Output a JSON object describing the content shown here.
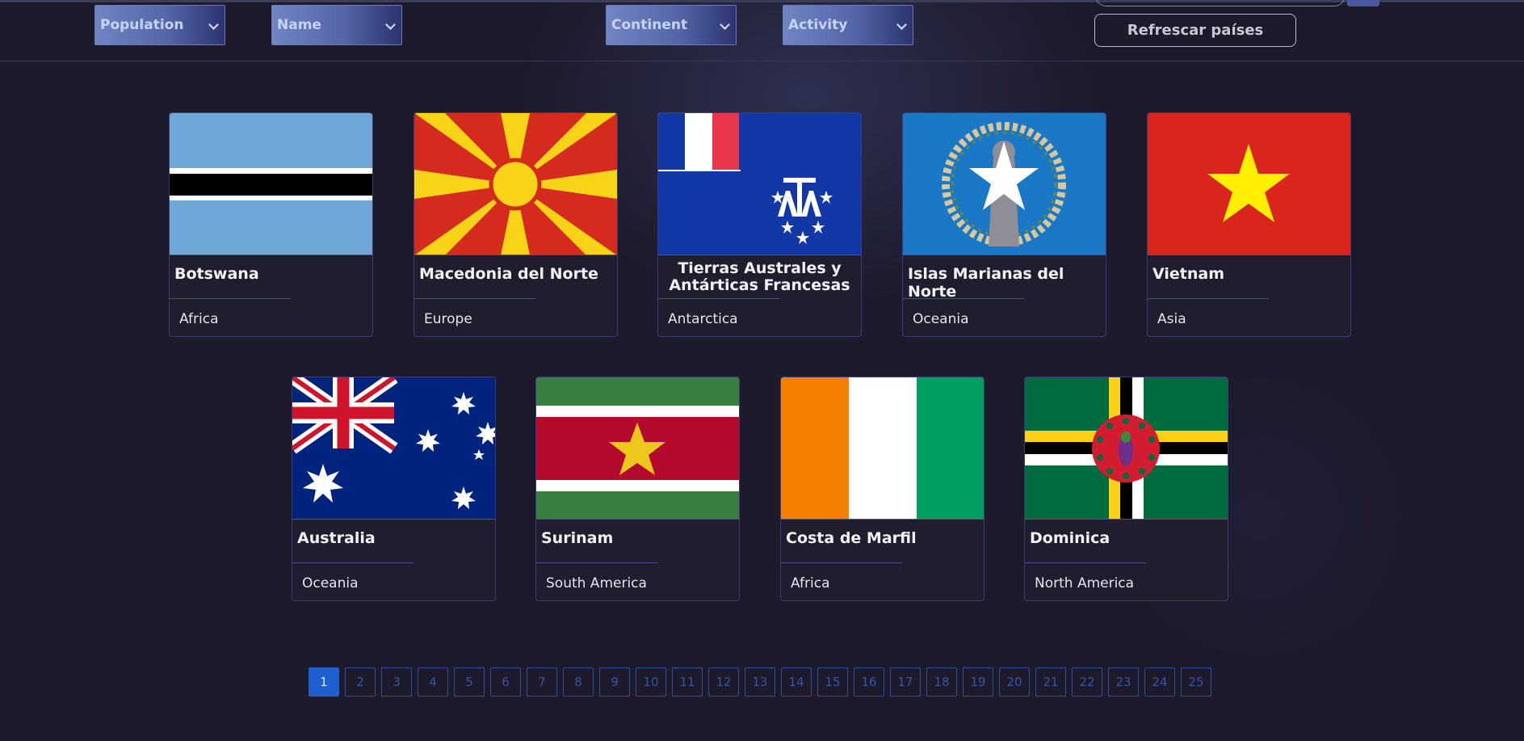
{
  "filters": {
    "population": "Population",
    "name": "Name",
    "continent": "Continent",
    "activity": "Activity"
  },
  "refresh_label": "Refrescar países",
  "countries": [
    {
      "name": "Botswana",
      "continent": "Africa",
      "flag": "botswana-flag"
    },
    {
      "name": "Macedonia del Norte",
      "continent": "Europe",
      "flag": "north-macedonia-flag"
    },
    {
      "name": "Tierras Australes y Antárticas Francesas",
      "continent": "Antarctica",
      "flag": "french-southern-lands-flag"
    },
    {
      "name": "Islas Marianas del Norte",
      "continent": "Oceania",
      "flag": "northern-mariana-islands-flag"
    },
    {
      "name": "Vietnam",
      "continent": "Asia",
      "flag": "vietnam-flag"
    },
    {
      "name": "Australia",
      "continent": "Oceania",
      "flag": "australia-flag"
    },
    {
      "name": "Surinam",
      "continent": "South America",
      "flag": "suriname-flag"
    },
    {
      "name": "Costa de Marfil",
      "continent": "Africa",
      "flag": "ivory-coast-flag"
    },
    {
      "name": "Dominica",
      "continent": "North America",
      "flag": "dominica-flag"
    }
  ],
  "pagination": {
    "current": "1",
    "pages": [
      "1",
      "2",
      "3",
      "4",
      "5",
      "6",
      "7",
      "8",
      "9",
      "10",
      "11",
      "12",
      "13",
      "14",
      "15",
      "16",
      "17",
      "18",
      "19",
      "20",
      "21",
      "22",
      "23",
      "24",
      "25"
    ]
  },
  "colors": {
    "background": "#1c1a2b",
    "card_border": "#3e3a78",
    "active_page": "#1f5fcf",
    "page_border": "#2b4f9a"
  }
}
